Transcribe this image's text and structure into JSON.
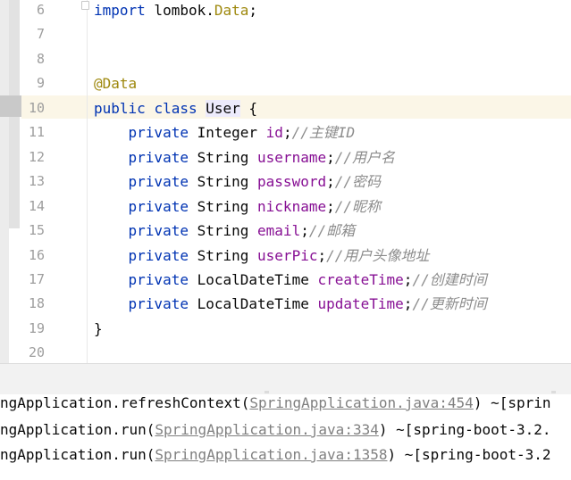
{
  "editor": {
    "lines": [
      {
        "num": "6",
        "tokens": [
          {
            "t": "import",
            "c": "kw"
          },
          {
            "t": " lombok.",
            "c": "cls"
          },
          {
            "t": "Data",
            "c": "cls-data"
          },
          {
            "t": ";",
            "c": "cls"
          }
        ]
      },
      {
        "num": "7",
        "tokens": []
      },
      {
        "num": "8",
        "tokens": []
      },
      {
        "num": "9",
        "tokens": [
          {
            "t": "@Data",
            "c": "ann"
          }
        ]
      },
      {
        "num": "10",
        "tokens": [
          {
            "t": "public",
            "c": "kw"
          },
          {
            "t": " ",
            "c": "cls"
          },
          {
            "t": "class",
            "c": "kw"
          },
          {
            "t": " ",
            "c": "cls"
          },
          {
            "t": "User",
            "c": "hl"
          },
          {
            "t": " {",
            "c": "cls"
          }
        ]
      },
      {
        "num": "11",
        "tokens": [
          {
            "t": "    private",
            "c": "kw"
          },
          {
            "t": " Integer ",
            "c": "cls"
          },
          {
            "t": "id",
            "c": "fld"
          },
          {
            "t": ";",
            "c": "cls"
          },
          {
            "t": "//主键ID",
            "c": "cmt"
          }
        ]
      },
      {
        "num": "12",
        "tokens": [
          {
            "t": "    private",
            "c": "kw"
          },
          {
            "t": " String ",
            "c": "cls"
          },
          {
            "t": "username",
            "c": "fld"
          },
          {
            "t": ";",
            "c": "cls"
          },
          {
            "t": "//用户名",
            "c": "cmt"
          }
        ]
      },
      {
        "num": "13",
        "tokens": [
          {
            "t": "    private",
            "c": "kw"
          },
          {
            "t": " String ",
            "c": "cls"
          },
          {
            "t": "password",
            "c": "fld"
          },
          {
            "t": ";",
            "c": "cls"
          },
          {
            "t": "//密码",
            "c": "cmt"
          }
        ]
      },
      {
        "num": "14",
        "tokens": [
          {
            "t": "    private",
            "c": "kw"
          },
          {
            "t": " String ",
            "c": "cls"
          },
          {
            "t": "nickname",
            "c": "fld"
          },
          {
            "t": ";",
            "c": "cls"
          },
          {
            "t": "//昵称",
            "c": "cmt"
          }
        ]
      },
      {
        "num": "15",
        "tokens": [
          {
            "t": "    private",
            "c": "kw"
          },
          {
            "t": " String ",
            "c": "cls"
          },
          {
            "t": "email",
            "c": "fld"
          },
          {
            "t": ";",
            "c": "cls"
          },
          {
            "t": "//邮箱",
            "c": "cmt"
          }
        ]
      },
      {
        "num": "16",
        "tokens": [
          {
            "t": "    private",
            "c": "kw"
          },
          {
            "t": " String ",
            "c": "cls"
          },
          {
            "t": "userPic",
            "c": "fld"
          },
          {
            "t": ";",
            "c": "cls"
          },
          {
            "t": "//用户头像地址",
            "c": "cmt"
          }
        ]
      },
      {
        "num": "17",
        "tokens": [
          {
            "t": "    private",
            "c": "kw"
          },
          {
            "t": " LocalDateTime ",
            "c": "cls"
          },
          {
            "t": "createTime",
            "c": "fld"
          },
          {
            "t": ";",
            "c": "cls"
          },
          {
            "t": "//创建时间",
            "c": "cmt"
          }
        ]
      },
      {
        "num": "18",
        "tokens": [
          {
            "t": "    private",
            "c": "kw"
          },
          {
            "t": " LocalDateTime ",
            "c": "cls"
          },
          {
            "t": "updateTime",
            "c": "fld"
          },
          {
            "t": ";",
            "c": "cls"
          },
          {
            "t": "//更新时间",
            "c": "cmt"
          }
        ]
      },
      {
        "num": "19",
        "tokens": [
          {
            "t": "}",
            "c": "cls"
          }
        ]
      },
      {
        "num": "20",
        "tokens": []
      }
    ]
  },
  "console": {
    "lines": [
      [
        {
          "t": "ngApplication.refreshContext(",
          "c": "txt"
        },
        {
          "t": "SpringApplication.java:454",
          "c": "link"
        },
        {
          "t": ") ~[sprin",
          "c": "txt"
        }
      ],
      [
        {
          "t": "ngApplication.run(",
          "c": "txt"
        },
        {
          "t": "SpringApplication.java:334",
          "c": "link"
        },
        {
          "t": ") ~[spring-boot-3.2.",
          "c": "txt"
        }
      ],
      [
        {
          "t": "ngApplication.run(",
          "c": "txt"
        },
        {
          "t": "SpringApplication.java:1358",
          "c": "link"
        },
        {
          "t": ") ~[spring-boot-3.2",
          "c": "txt"
        }
      ]
    ]
  },
  "colors": {
    "keyword": "#0033b3",
    "field": "#871094",
    "comment": "#8c8c8c",
    "annotation": "#9e880d",
    "line_number": "#9e9e9e",
    "current_line": "#fbf6e7",
    "link": "#7f7f7f"
  }
}
